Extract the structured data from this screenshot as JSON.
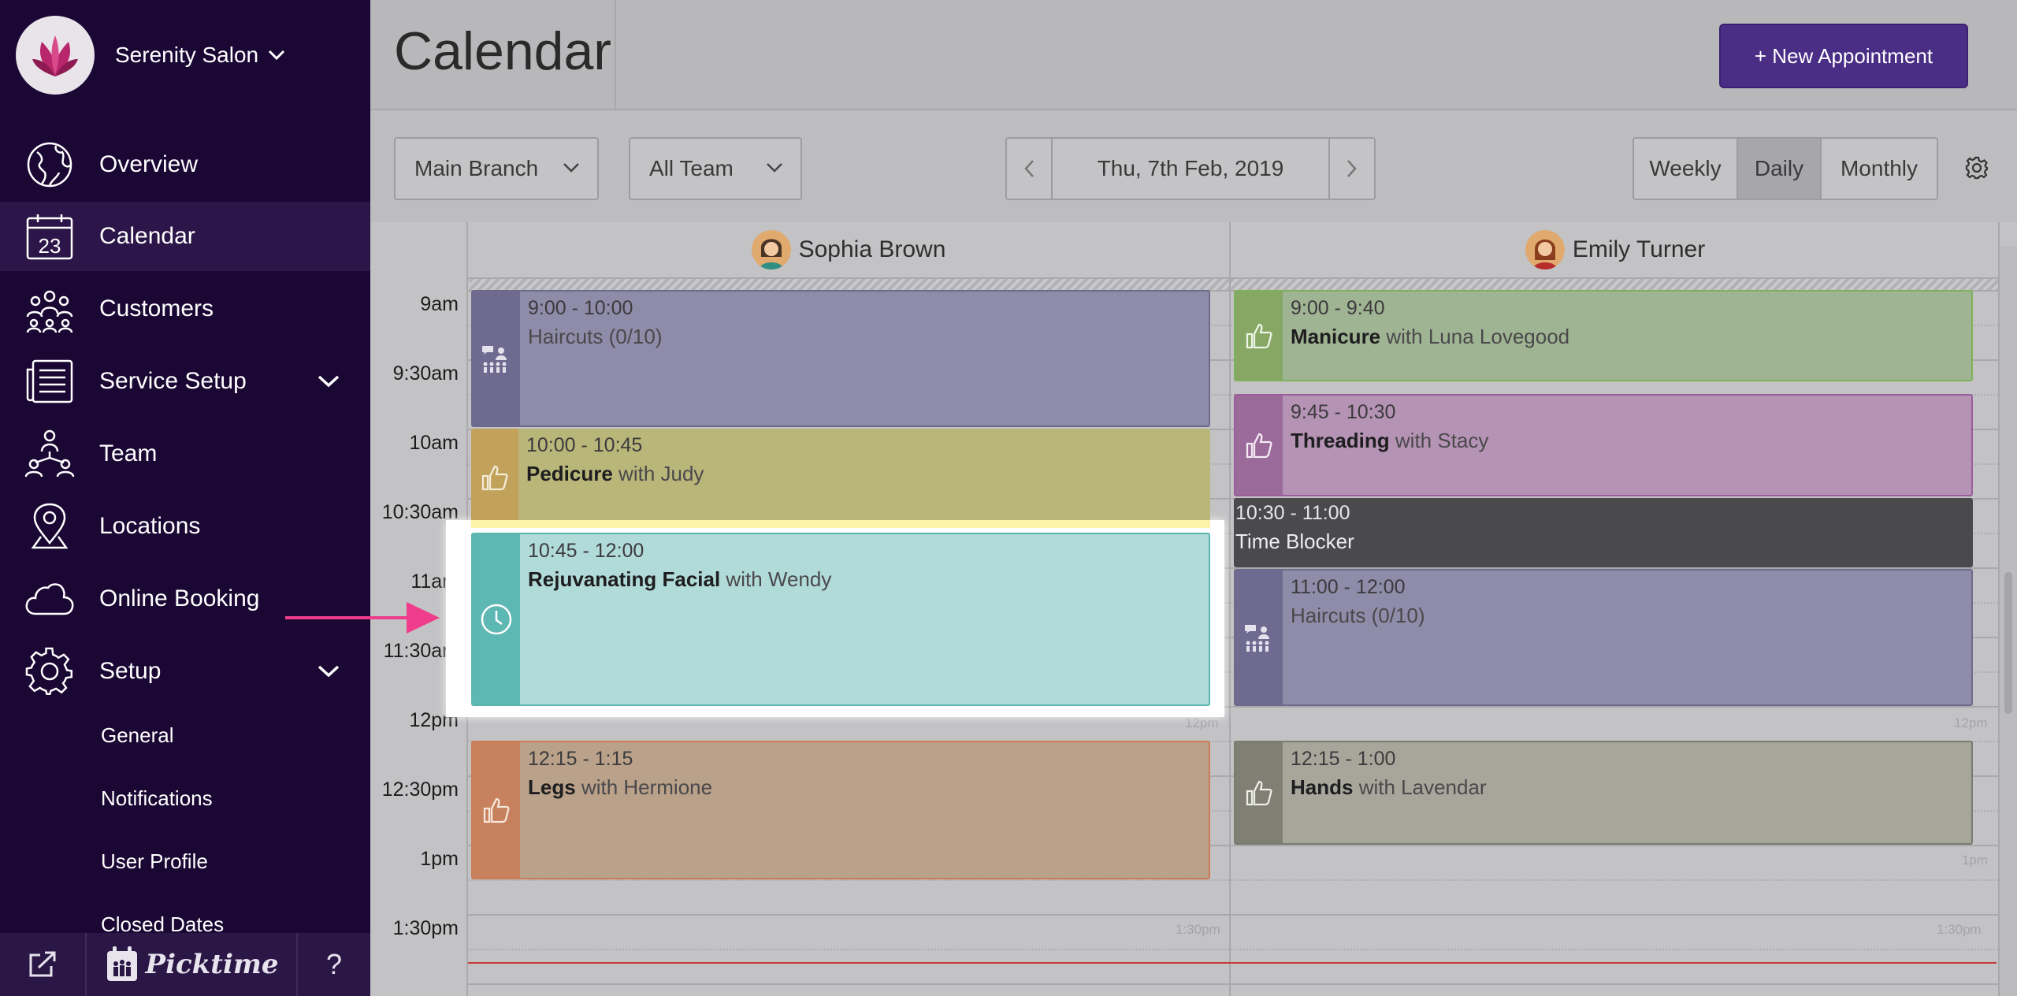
{
  "sidebar": {
    "salon_name": "Serenity Salon",
    "items": [
      {
        "label": "Overview",
        "icon": "globe-icon"
      },
      {
        "label": "Calendar",
        "icon": "calendar-icon",
        "day": "23"
      },
      {
        "label": "Customers",
        "icon": "customers-icon"
      },
      {
        "label": "Service Setup",
        "icon": "list-icon"
      },
      {
        "label": "Team",
        "icon": "team-icon"
      },
      {
        "label": "Locations",
        "icon": "location-pin-icon"
      },
      {
        "label": "Online Booking",
        "icon": "cloud-icon"
      },
      {
        "label": "Setup",
        "icon": "gear-icon"
      }
    ],
    "sub_items": [
      "General",
      "Notifications",
      "User Profile",
      "Closed Dates"
    ],
    "footer": {
      "logo_text": "Picktime",
      "help": "?"
    }
  },
  "header": {
    "title": "Calendar",
    "new_button": "+ New Appointment"
  },
  "toolbar": {
    "branch": "Main Branch",
    "team": "All Team",
    "date": "Thu, 7th Feb, 2019",
    "views": [
      "Weekly",
      "Daily",
      "Monthly"
    ],
    "active_view": "Daily"
  },
  "calendar": {
    "staff": [
      "Sophia Brown",
      "Emily Turner"
    ],
    "times": [
      "9am",
      "9:30am",
      "10am",
      "10:30am",
      "11am",
      "11:30am",
      "12pm",
      "12:30pm",
      "1pm",
      "1:30pm"
    ],
    "ghost_labels": {
      "noon": "12pm",
      "half_one": "1:30pm",
      "one": "1pm"
    },
    "appointments": {
      "sophia": [
        {
          "time": "9:00 - 10:00",
          "service": "Haircuts (0/10)",
          "with": ""
        },
        {
          "time": "10:00 - 10:45",
          "service": "Pedicure",
          "with": " with Judy"
        },
        {
          "time": "10:45 - 12:00",
          "service": "Rejuvanating Facial",
          "with": " with Wendy"
        },
        {
          "time": "12:15 - 1:15",
          "service": "Legs",
          "with": " with Hermione"
        }
      ],
      "emily": [
        {
          "time": "9:00 - 9:40",
          "service": "Manicure",
          "with": " with Luna Lovegood"
        },
        {
          "time": "9:45 - 10:30",
          "service": "Threading",
          "with": " with Stacy"
        },
        {
          "time": "10:30 - 11:00",
          "service": "Time Blocker",
          "with": ""
        },
        {
          "time": "11:00 - 12:00",
          "service": "Haircuts (0/10)",
          "with": ""
        },
        {
          "time": "12:15 - 1:00",
          "service": "Hands",
          "with": " with Lavendar"
        }
      ]
    }
  },
  "colors": {
    "sidebar_bg": "#1a0733",
    "accent": "#4a2e85",
    "now_line": "#c63b36",
    "highlight_arrow": "#ef3d8b"
  }
}
